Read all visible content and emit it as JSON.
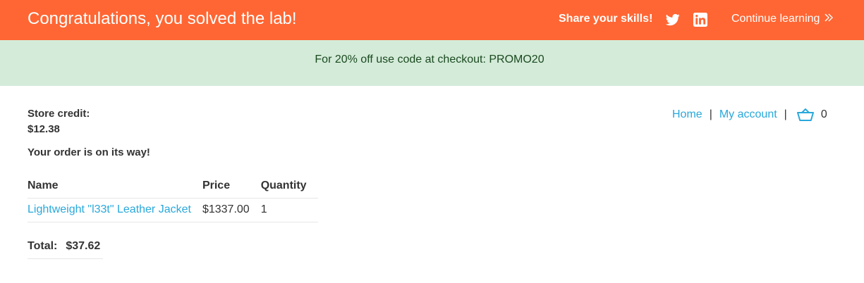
{
  "colors": {
    "banner_bg": "#ff6633",
    "promo_bg": "#d4ebd9",
    "link": "#29a8db",
    "text": "#333333"
  },
  "banner": {
    "title": "Congratulations, you solved the lab!",
    "share_label": "Share your skills!",
    "icons": [
      "twitter-icon",
      "linkedin-icon"
    ],
    "continue_label": "Continue learning"
  },
  "promo": {
    "text": "For 20% off use code at checkout: PROMO20"
  },
  "account": {
    "credit_label": "Store credit:",
    "credit_value": "$12.38"
  },
  "nav": {
    "home": "Home",
    "separator": "|",
    "my_account": "My account",
    "cart_count": "0"
  },
  "order": {
    "message": "Your order is on its way!",
    "columns": [
      "Name",
      "Price",
      "Quantity"
    ],
    "rows": [
      {
        "name": "Lightweight \"l33t\" Leather Jacket",
        "price": "$1337.00",
        "quantity": "1"
      }
    ],
    "total_label": "Total:",
    "total_value": "$37.62"
  }
}
